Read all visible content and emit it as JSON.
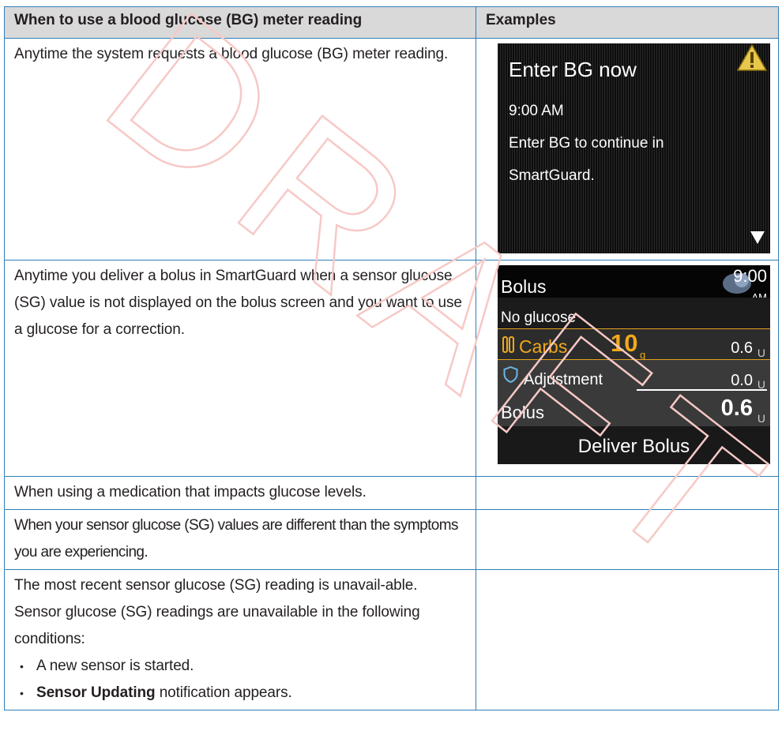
{
  "watermark": "DRAFT",
  "table": {
    "headers": {
      "when": "When to use a blood glucose (BG) meter reading",
      "examples": "Examples"
    },
    "rows": [
      {
        "text": "Anytime the system requests a blood glucose (BG) meter reading."
      },
      {
        "text": "Anytime you deliver a bolus in SmartGuard when a sensor glucose (SG) value is not displayed on the bolus screen and you want to use a glucose for a correction."
      },
      {
        "text": "When using a medication that impacts glucose levels."
      },
      {
        "text": "When your sensor glucose (SG) values are different than the symptoms you are experiencing."
      },
      {
        "text": "The most recent sensor glucose (SG) reading is unavail-able. Sensor glucose (SG) readings are unavailable in the following conditions:",
        "bullets": [
          {
            "text": "A new sensor is started."
          },
          {
            "bold": "Sensor Updating",
            "after": " notification appears."
          }
        ]
      }
    ]
  },
  "screen1": {
    "title": "Enter BG now",
    "time": "9:00 AM",
    "line1": "Enter BG to continue in",
    "line2": "SmartGuard.",
    "icons": [
      "warning-icon",
      "scroll-down-arrow-icon"
    ]
  },
  "screen2": {
    "title": "Bolus",
    "time": "9:00",
    "ampm": "AM",
    "glucose": "No glucose",
    "carbs_label": "Carbs",
    "carbs_value": "10",
    "carbs_unit": "g",
    "carbs_insulin": "0.6",
    "adjustment_label": "Adjustment",
    "adjustment_value": "0.0",
    "bolus_label": "Bolus",
    "bolus_value": "0.6",
    "unit": "U",
    "button": "Deliver Bolus",
    "colors": {
      "accent": "#f0a91c",
      "shield": "#6ab7e6",
      "border": "#2f7eb8",
      "header_bg": "#d9d9d9"
    }
  }
}
